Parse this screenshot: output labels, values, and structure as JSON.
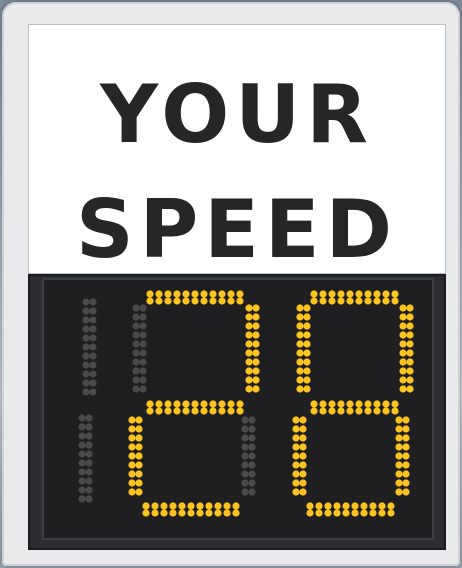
{
  "sign": {
    "title_line_1": "YOUR",
    "title_line_2": "SPEED"
  },
  "display": {
    "speed_value": "28",
    "digits": [
      "",
      "2",
      "8"
    ],
    "lit_color": "#ffc31f",
    "unlit_color": "#4a4a4c"
  }
}
